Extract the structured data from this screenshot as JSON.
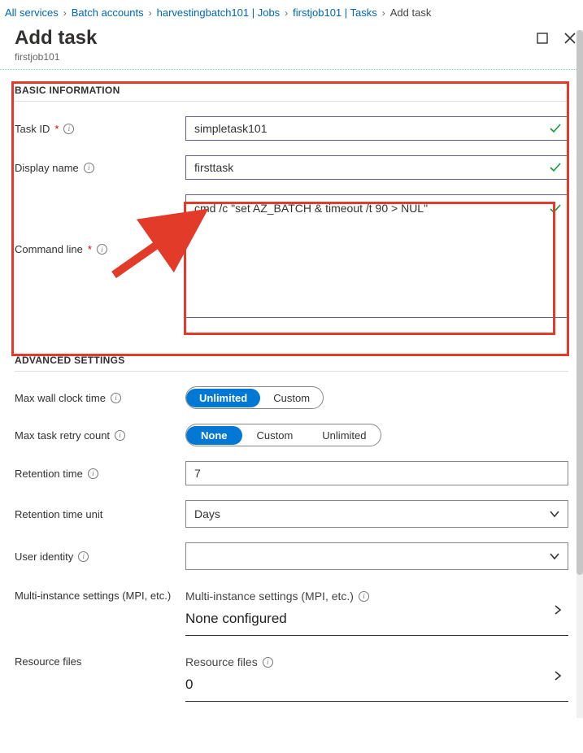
{
  "breadcrumb": {
    "items": [
      {
        "label": "All services"
      },
      {
        "label": "Batch accounts"
      },
      {
        "label": "harvestingbatch101 | Jobs"
      },
      {
        "label": "firstjob101 | Tasks"
      }
    ],
    "current": "Add task"
  },
  "header": {
    "title": "Add task",
    "subtitle": "firstjob101"
  },
  "basic": {
    "section_title": "BASIC INFORMATION",
    "task_id_label": "Task ID",
    "task_id_value": "simpletask101",
    "display_name_label": "Display name",
    "display_name_value": "firsttask",
    "command_line_label": "Command line",
    "command_line_value": "cmd /c \"set AZ_BATCH & timeout /t 90 > NUL\""
  },
  "advanced": {
    "section_title": "ADVANCED SETTINGS",
    "max_wall_clock_label": "Max wall clock time",
    "max_wall_clock_options": [
      "Unlimited",
      "Custom"
    ],
    "max_wall_clock_selected": "Unlimited",
    "max_retry_label": "Max task retry count",
    "max_retry_options": [
      "None",
      "Custom",
      "Unlimited"
    ],
    "max_retry_selected": "None",
    "retention_time_label": "Retention time",
    "retention_time_value": "7",
    "retention_unit_label": "Retention time unit",
    "retention_unit_value": "Days",
    "user_identity_label": "User identity",
    "user_identity_value": "",
    "multi_instance_label": "Multi-instance settings (MPI, etc.)",
    "multi_instance_header": "Multi-instance settings (MPI, etc.)",
    "multi_instance_value": "None configured",
    "resource_files_label": "Resource files",
    "resource_files_header": "Resource files",
    "resource_files_value": "0"
  }
}
